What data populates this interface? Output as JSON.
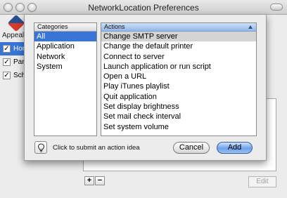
{
  "window": {
    "title": "NetworkLocation Preferences",
    "toolbar_label": "Appeal"
  },
  "background_list": [
    {
      "label": "Hom",
      "checked": true,
      "selected": true
    },
    {
      "label": "Par",
      "checked": true,
      "selected": false
    },
    {
      "label": "Sch",
      "checked": true,
      "selected": false
    }
  ],
  "background_buttons": {
    "plus": "+",
    "minus": "−",
    "edit": "Edit"
  },
  "sheet": {
    "categories_header": "Categories",
    "categories": [
      "All",
      "Application",
      "Network",
      "System"
    ],
    "selected_category": "All",
    "actions_header": "Actions",
    "actions": [
      "Change SMTP server",
      "Change the default printer",
      "Connect to server",
      "Launch application or run script",
      "Open a URL",
      "Play iTunes playlist",
      "Quit application",
      "Set display brightness",
      "Set mail check interval",
      "Set system volume"
    ],
    "selected_action": "Change SMTP server",
    "idea_label": "Click to submit an action idea",
    "cancel_label": "Cancel",
    "add_label": "Add"
  },
  "colors": {
    "selection_blue": "#3875d7",
    "header_blue": "#90b6ea"
  },
  "icons": [
    "lightbulb-icon",
    "sort-ascending-icon",
    "check-icon"
  ]
}
